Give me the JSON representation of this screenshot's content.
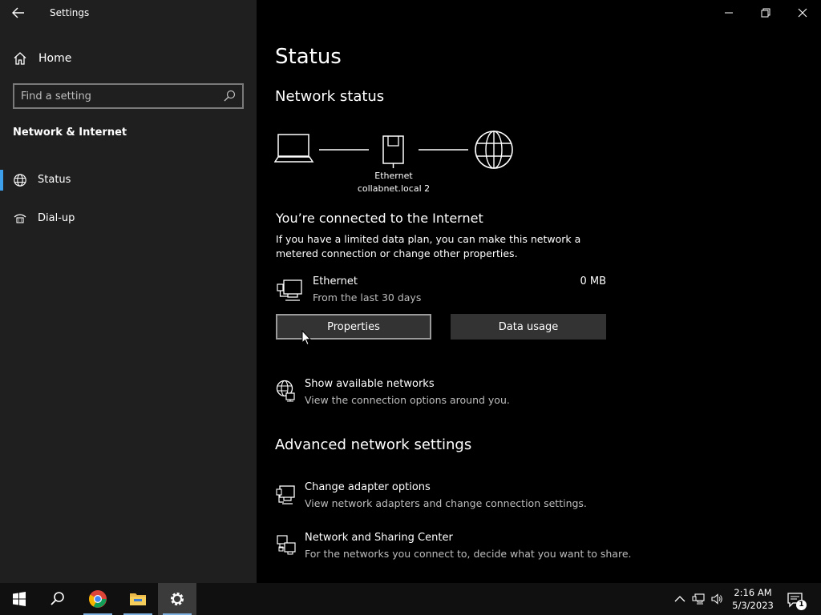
{
  "window": {
    "title": "Settings"
  },
  "sidebar": {
    "home_label": "Home",
    "search_placeholder": "Find a setting",
    "section_title": "Network & Internet",
    "items": [
      {
        "label": "Status",
        "icon": "globe-icon",
        "selected": true
      },
      {
        "label": "Dial-up",
        "icon": "dialup-icon",
        "selected": false
      }
    ]
  },
  "main": {
    "title": "Status",
    "network_status_heading": "Network status",
    "diagram": {
      "adapter_label": "Ethernet",
      "network_name": "collabnet.local 2"
    },
    "connected_text": "You’re connected to the Internet",
    "description": "If you have a limited data plan, you can make this network a metered connection or change other properties.",
    "connection": {
      "name": "Ethernet",
      "period": "From the last 30 days",
      "usage": "0 MB"
    },
    "buttons": {
      "properties": "Properties",
      "data_usage": "Data usage"
    },
    "show_networks": {
      "title": "Show available networks",
      "subtitle": "View the connection options around you."
    },
    "advanced_heading": "Advanced network settings",
    "advanced_items": [
      {
        "title": "Change adapter options",
        "subtitle": "View network adapters and change connection settings."
      },
      {
        "title": "Network and Sharing Center",
        "subtitle": "For the networks you connect to, decide what you want to share."
      }
    ]
  },
  "taskbar": {
    "apps": [
      "start-icon",
      "search-icon",
      "chrome-icon",
      "file-explorer-icon",
      "settings-icon"
    ],
    "time": "2:16 AM",
    "date": "5/3/2023",
    "notification_count": "1"
  },
  "colors": {
    "accent": "#3d9ee9",
    "sidebar_bg": "#1f1f1f",
    "main_bg": "#000000",
    "button_bg": "#333333"
  }
}
